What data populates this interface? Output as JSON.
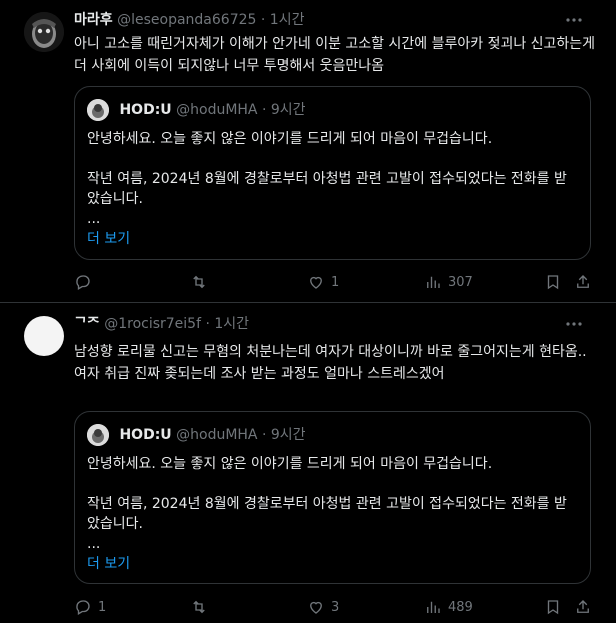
{
  "posts": [
    {
      "display_name": "마라후",
      "handle": "@leseopanda66725",
      "separator": "·",
      "time": "1시간",
      "text": "아니 고소를 때린거자체가 이해가 안가네 이분 고소할 시간에 블루아카 젖괴나 신고하는게 더 사회에 이득이 되지않나 너무 투명해서 웃음만나옴",
      "quote": {
        "display_name": "HOD:U",
        "handle": "@hoduMHA",
        "separator": "·",
        "time": "9시간",
        "line1": "안녕하세요. 오늘 좋지 않은 이야기를 드리게 되어 마음이 무겁습니다.",
        "line2": "작년 여름, 2024년 8월에 경찰로부터 아청법 관련 고발이 접수되었다는 전화를 받았습니다.",
        "ellipsis": "...",
        "show_more": "더 보기"
      },
      "actions": {
        "replies": "",
        "reposts": "",
        "likes": "1",
        "views": "307"
      }
    },
    {
      "display_name": "ᄀᄌ",
      "handle": "@1rocisr7ei5f",
      "separator": "·",
      "time": "1시간",
      "text": "남성향 로리물 신고는 무혐의 처분나는데 여자가 대상이니까 바로 줄그어지는게 현타옴..\n여자 취급 진짜 좆되는데 조사 받는 과정도 얼마나 스트레스겠어",
      "quote": {
        "display_name": "HOD:U",
        "handle": "@hoduMHA",
        "separator": "·",
        "time": "9시간",
        "line1": "안녕하세요. 오늘 좋지 않은 이야기를 드리게 되어 마음이 무겁습니다.",
        "line2": "작년 여름, 2024년 8월에 경찰로부터 아청법 관련 고발이 접수되었다는 전화를 받았습니다.",
        "ellipsis": "...",
        "show_more": "더 보기"
      },
      "actions": {
        "replies": "1",
        "reposts": "",
        "likes": "3",
        "views": "489"
      }
    }
  ],
  "icons": [
    "more-icon",
    "reply-icon",
    "repost-icon",
    "like-icon",
    "views-icon",
    "bookmark-icon",
    "share-icon"
  ],
  "colors": {
    "background": "#000000",
    "text": "#e7e9ea",
    "muted": "#71767b",
    "link": "#1d9bf0",
    "border": "#2f3336"
  }
}
